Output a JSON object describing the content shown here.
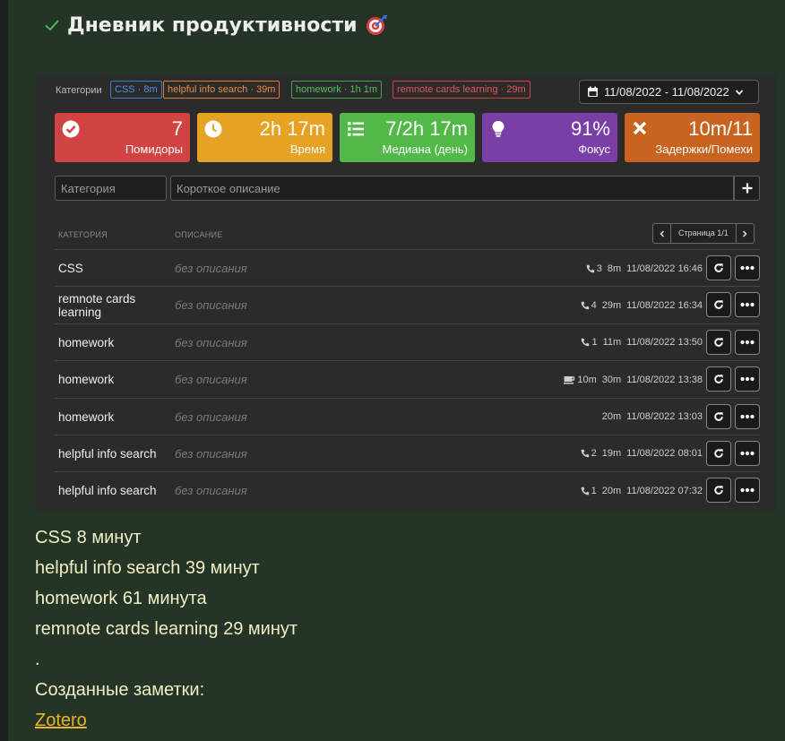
{
  "page": {
    "title": "Дневник продуктивности",
    "title_icon": "target-dart-icon",
    "check_icon": "checkmark-icon"
  },
  "colors": {
    "background": "#243426",
    "widget_bg": "#2b2b2b",
    "summary_text": "#f1efc4",
    "link": "#e8b42a"
  },
  "filter": {
    "label": "Категории",
    "tags": [
      {
        "name": "CSS",
        "duration": "8m",
        "text": "CSS · 8m",
        "color": "#3a7fcf"
      },
      {
        "name": "helpful info search",
        "duration": "39m",
        "text": "helpful info search · 39m",
        "color": "#e8752c"
      },
      {
        "name": "homework",
        "duration": "1h 1m",
        "text": "homework · 1h 1m",
        "color": "#3ba548"
      },
      {
        "name": "remnote cards learning",
        "duration": "29m",
        "text": "remnote cards learning · 29m",
        "color": "#d23f3f"
      }
    ],
    "date_range": "11/08/2022 - 11/08/2022"
  },
  "stats": [
    {
      "value": "7",
      "label": "Помидоры",
      "icon": "check-circle-icon",
      "color": "#d24343"
    },
    {
      "value": "2h 17m",
      "label": "Время",
      "icon": "clock-icon",
      "color": "#e5a223"
    },
    {
      "value": "7/2h 17m",
      "label": "Медиана (день)",
      "icon": "list-icon",
      "color": "#52b948"
    },
    {
      "value": "91%",
      "label": "Фокус",
      "icon": "lightbulb-icon",
      "color": "#7a3fa6"
    },
    {
      "value": "10m/11",
      "label": "Задержки/Помехи",
      "icon": "times-icon",
      "color": "#c8641f"
    }
  ],
  "form": {
    "category_placeholder": "Категория",
    "description_placeholder": "Короткое описание"
  },
  "table": {
    "headers": {
      "category": "КАТЕГОРИЯ",
      "description": "ОПИСАНИЕ"
    },
    "pager": "Страница 1/1",
    "rows": [
      {
        "category": "CSS",
        "description": "без описания",
        "interruptions": "3",
        "interruption_icon": "phone-icon",
        "duration": "8m",
        "timestamp": "11/08/2022 16:46"
      },
      {
        "category": "remnote cards learning",
        "description": "без описания",
        "interruptions": "4",
        "interruption_icon": "phone-icon",
        "duration": "29m",
        "timestamp": "11/08/2022 16:34"
      },
      {
        "category": "homework",
        "description": "без описания",
        "interruptions": "1",
        "interruption_icon": "phone-icon",
        "duration": "11m",
        "timestamp": "11/08/2022 13:50"
      },
      {
        "category": "homework",
        "description": "без описания",
        "interruptions": "10m",
        "interruption_icon": "coffee-icon",
        "duration": "30m",
        "timestamp": "11/08/2022 13:38"
      },
      {
        "category": "homework",
        "description": "без описания",
        "interruptions": "",
        "interruption_icon": "",
        "duration": "20m",
        "timestamp": "11/08/2022 13:03"
      },
      {
        "category": "helpful info search",
        "description": "без описания",
        "interruptions": "2",
        "interruption_icon": "phone-icon",
        "duration": "19m",
        "timestamp": "11/08/2022 08:01"
      },
      {
        "category": "helpful info search",
        "description": "без описания",
        "interruptions": "1",
        "interruption_icon": "phone-icon",
        "duration": "20m",
        "timestamp": "11/08/2022 07:32"
      }
    ]
  },
  "summary": {
    "lines": [
      "CSS 8 минут",
      "helpful info search 39 минут",
      "homework 61 минута",
      "remnote cards learning 29 минут",
      "."
    ],
    "notes_label": "Созданные заметки:",
    "link_text": "Zotero"
  }
}
